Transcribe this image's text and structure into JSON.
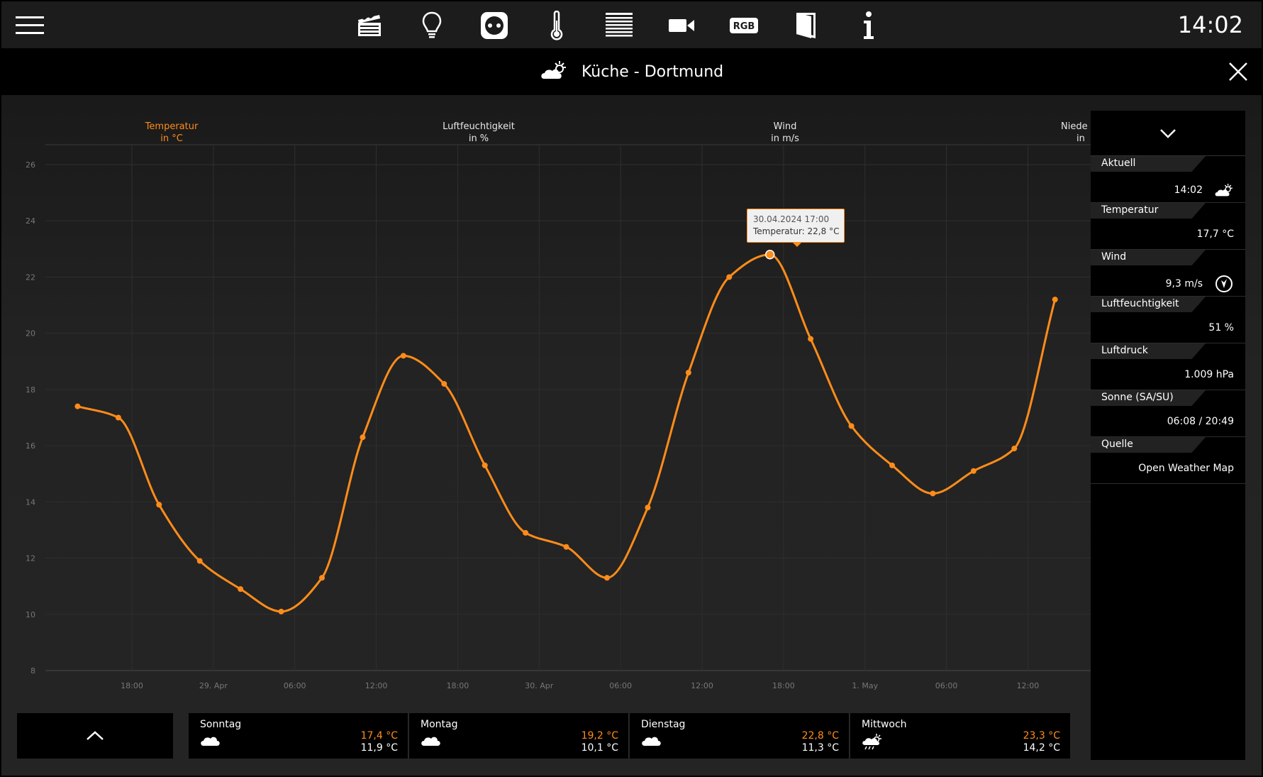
{
  "topbar": {
    "clock": "14:02",
    "icons": [
      "scenes-icon",
      "lightbulb-icon",
      "power-socket-icon",
      "thermometer-icon",
      "blinds-icon",
      "camera-icon",
      "rgb-icon",
      "door-icon",
      "info-icon"
    ],
    "rgb_label": "RGB",
    "info_label": "i"
  },
  "titlebar": {
    "title": "Küche - Dortmund"
  },
  "chart_tabs": [
    {
      "line1": "Temperatur",
      "line2": "in °C"
    },
    {
      "line1": "Luftfeuchtigkeit",
      "line2": "in %"
    },
    {
      "line1": "Wind",
      "line2": "in m/s"
    },
    {
      "line1": "Niede",
      "line2": "in"
    }
  ],
  "tooltip": {
    "line1": "30.04.2024 17:00",
    "line2": "Temperatur: 22,8 °C"
  },
  "chart_data": {
    "type": "line",
    "ylim": [
      8,
      26
    ],
    "yticks": [
      8,
      10,
      12,
      14,
      16,
      18,
      20,
      22,
      24,
      26
    ],
    "xticks": [
      "18:00",
      "29. Apr",
      "06:00",
      "12:00",
      "18:00",
      "30. Apr",
      "06:00",
      "12:00",
      "18:00",
      "1. May",
      "06:00",
      "12:00"
    ],
    "xtick_hours": [
      18,
      24,
      30,
      36,
      42,
      48,
      54,
      60,
      66,
      72,
      78,
      84
    ],
    "x_hours": [
      14,
      17,
      20,
      23,
      26,
      29,
      32,
      35,
      38,
      41,
      44,
      47,
      50,
      53,
      56,
      59,
      62,
      65,
      68,
      71,
      74,
      77,
      80,
      83,
      86
    ],
    "series": [
      {
        "values": [
          17.4,
          17.0,
          13.9,
          11.9,
          10.9,
          10.1,
          11.3,
          16.3,
          19.2,
          18.2,
          15.3,
          12.9,
          12.4,
          11.3,
          13.8,
          18.6,
          22.0,
          22.8,
          19.8,
          16.7,
          15.3,
          14.3,
          15.1,
          15.9,
          21.2
        ]
      }
    ],
    "color": "#ff8c1a",
    "grid": true
  },
  "sidepanel": {
    "sections": [
      {
        "label": "Aktuell",
        "value": "14:02",
        "icon": "partly-cloudy-icon"
      },
      {
        "label": "Temperatur",
        "value": "17,7 °C",
        "icon": ""
      },
      {
        "label": "Wind",
        "value": "9,3 m/s",
        "icon": "wind-direction-icon"
      },
      {
        "label": "Luftfeuchtigkeit",
        "value": "51 %",
        "icon": ""
      },
      {
        "label": "Luftdruck",
        "value": "1.009 hPa",
        "icon": ""
      },
      {
        "label": "Sonne (SA/SU)",
        "value": "06:08 / 20:49",
        "icon": ""
      },
      {
        "label": "Quelle",
        "value": "Open Weather Map",
        "icon": ""
      }
    ]
  },
  "forecast": [
    {
      "day": "Sonntag",
      "max": "17,4 °C",
      "min": "11,9 °C",
      "icon": "cloudy-icon"
    },
    {
      "day": "Montag",
      "max": "19,2 °C",
      "min": "10,1 °C",
      "icon": "cloudy-icon"
    },
    {
      "day": "Dienstag",
      "max": "22,8 °C",
      "min": "11,3 °C",
      "icon": "cloudy-icon"
    },
    {
      "day": "Mittwoch",
      "max": "23,3 °C",
      "min": "14,2 °C",
      "icon": "sun-rain-icon"
    }
  ],
  "colors": {
    "accent": "#ff8c1a",
    "background": "#1c1c1c",
    "panel": "#000000"
  }
}
